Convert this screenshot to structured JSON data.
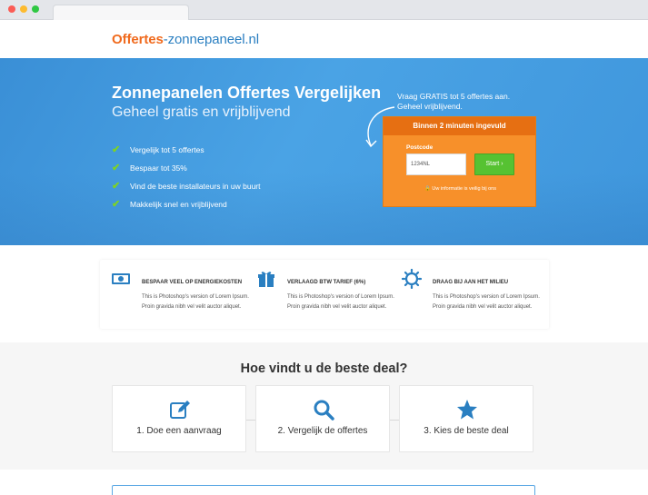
{
  "colors": {
    "accent": "#2a7fc1",
    "brand_orange": "#f06a1d",
    "hero_blue": "#4aa3e5",
    "form_orange": "#f7902a",
    "button_green": "#56c232",
    "check_green": "#7ed321"
  },
  "header": {
    "logo_part1": "Offertes",
    "logo_part2": "-zonnepaneel.nl"
  },
  "hero": {
    "title": "Zonnepanelen Offertes Vergelijken",
    "subtitle": "Geheel gratis en vrijblijvend",
    "benefits": [
      "Vergelijk tot 5 offertes",
      "Bespaar tot 35%",
      "Vind de beste installateurs in uw buurt",
      "Makkelijk snel en vrijblijvend"
    ],
    "hint_line1": "Vraag GRATIS tot 5 offertes aan.",
    "hint_line2": "Geheel vrijblijvend."
  },
  "form": {
    "heading": "Binnen 2 minuten ingevuld",
    "postcode_label": "Postcode",
    "postcode_placeholder": "1234NL",
    "start_button": "Start ›",
    "secure_text": "🔒 Uw informatie is veilig bij ons"
  },
  "features": [
    {
      "icon": "money-icon",
      "title": "BESPAAR VEEL OP ENERGIEKOSTEN",
      "text": "This is Photoshop's version of Lorem Ipsum. Proin gravida nibh vel velit auctor aliquet."
    },
    {
      "icon": "gift-icon",
      "title": "VERLAAGD BTW TARIEF (6%)",
      "text": "This is Photoshop's version of Lorem Ipsum. Proin gravida nibh vel velit auctor aliquet."
    },
    {
      "icon": "sun-icon",
      "title": "DRAAG BIJ AAN HET MILIEU",
      "text": "This is Photoshop's version of Lorem Ipsum. Proin gravida nibh vel velit auctor aliquet."
    }
  ],
  "how": {
    "title": "Hoe vindt u de beste deal?",
    "steps": [
      {
        "icon": "edit-icon",
        "label": "1. Doe een aanvraag"
      },
      {
        "icon": "search-icon",
        "label": "2. Vergelijk de offertes"
      },
      {
        "icon": "star-icon",
        "label": "3. Kies de beste deal"
      }
    ]
  }
}
